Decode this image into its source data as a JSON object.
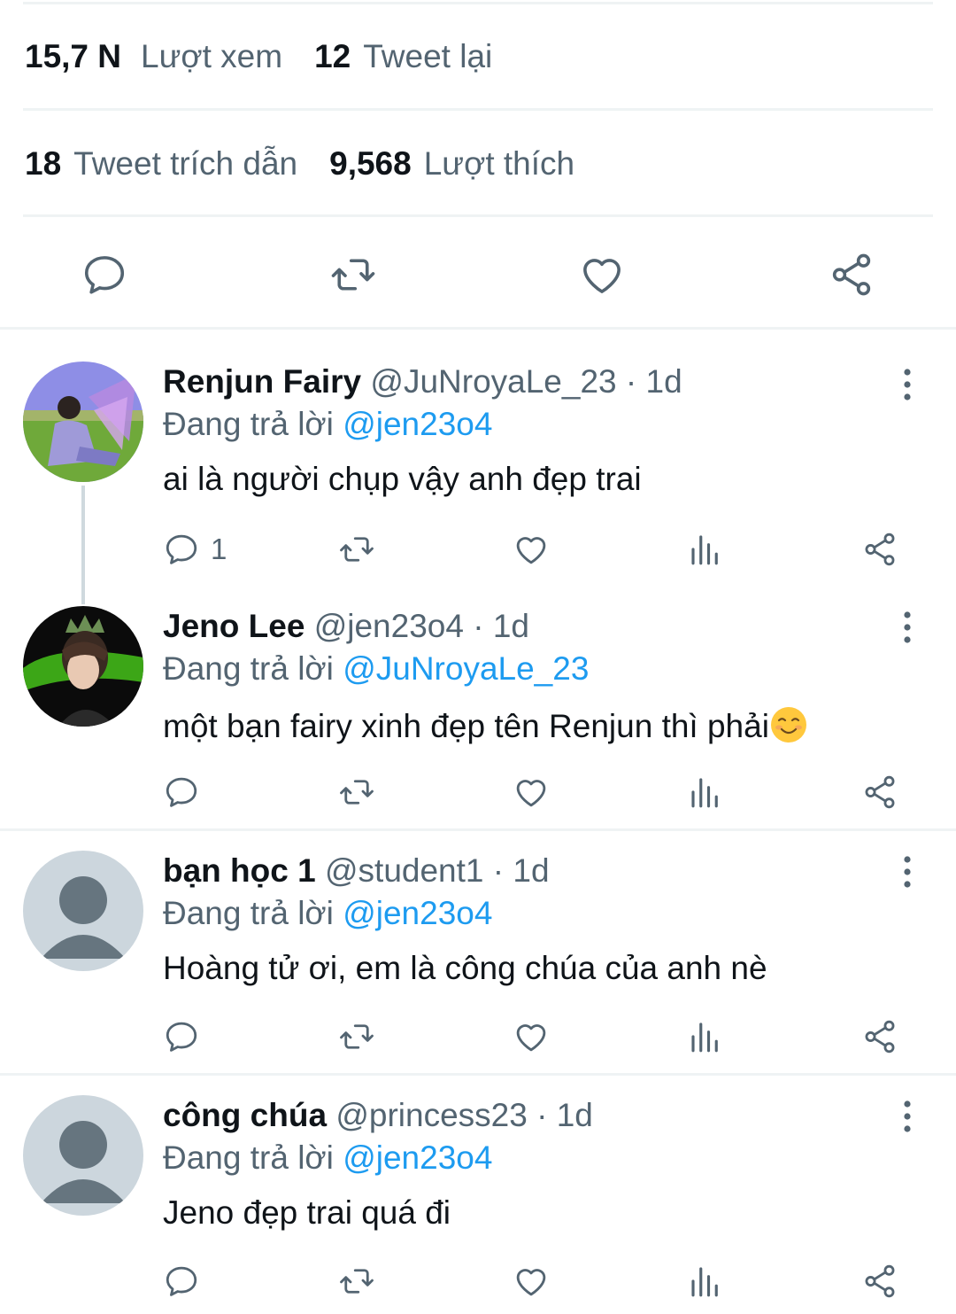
{
  "tweet_stats": {
    "views_count": "15,7 N",
    "views_label": "Lượt xem",
    "retweets_count": "12",
    "retweets_label": "Tweet lại",
    "quotes_count": "18",
    "quotes_label": "Tweet trích dẫn",
    "likes_count": "9,568",
    "likes_label": "Lượt thích"
  },
  "replying_label": "Đang trả lời",
  "replies": [
    {
      "name": "Renjun Fairy",
      "handle": "@JuNroyaLe_23",
      "separator": "·",
      "time": "1d",
      "replying_to": "@jen23o4",
      "text": "ai là người chụp vậy anh đẹp trai",
      "reply_count": "1"
    },
    {
      "name": "Jeno Lee",
      "handle": "@jen23o4",
      "separator": "·",
      "time": "1d",
      "replying_to": "@JuNroyaLe_23",
      "text": "một bạn fairy xinh đẹp tên Renjun thì phải",
      "emoji": "smiling-face-emoji",
      "reply_count": ""
    },
    {
      "name": "bạn học 1",
      "handle": "@student1",
      "separator": "·",
      "time": "1d",
      "replying_to": "@jen23o4",
      "text": "Hoàng tử ơi, em là công chúa của anh nè",
      "reply_count": ""
    },
    {
      "name": "công chúa",
      "handle": "@princess23",
      "separator": "·",
      "time": "1d",
      "replying_to": "@jen23o4",
      "text": "Jeno đẹp trai quá đi",
      "reply_count": ""
    }
  ],
  "colors": {
    "text_primary": "#0f1419",
    "text_secondary": "#536471",
    "link": "#1d9bf0",
    "divider": "#eff3f4",
    "default_avatar_bg": "#ccd6dd",
    "default_avatar_fg": "#66757f"
  },
  "icons": [
    "reply-icon",
    "retweet-icon",
    "like-icon",
    "share-icon",
    "views-icon",
    "more-icon"
  ]
}
